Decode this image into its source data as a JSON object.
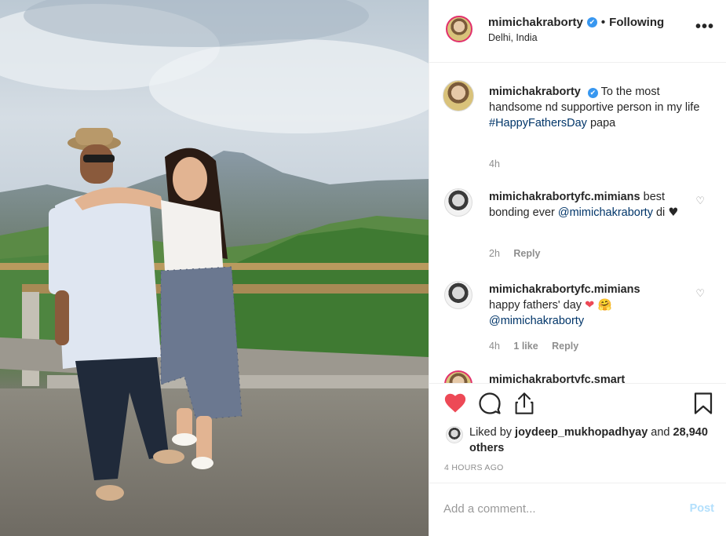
{
  "header": {
    "username": "mimichakraborty",
    "verified_mark": "✔",
    "separator": "•",
    "follow_status": "Following",
    "location": "Delhi, India",
    "more_icon": "•••"
  },
  "caption": {
    "username": "mimichakraborty",
    "verified_mark": "✔",
    "text": "To the most handsome nd supportive person in my life",
    "hashtag": "#HappyFathersDay",
    "text_after": "papa",
    "time": "4h"
  },
  "comments": [
    {
      "username": "mimichakrabortyfc.mimians",
      "text_before": "best bonding ever",
      "mention": "@mimichakraborty",
      "text_after": "di",
      "emoji": "♥",
      "time": "2h",
      "reply_label": "Reply"
    },
    {
      "username": "mimichakrabortyfc.mimians",
      "text_before": "happy fathers' day",
      "emoji": "❤ 🤗",
      "mention": "@mimichakraborty",
      "time": "4h",
      "likes": "1 like",
      "reply_label": "Reply"
    },
    {
      "username_partial": "mimichakrabortyfc.smart"
    }
  ],
  "likes": {
    "prefix": "Liked by",
    "user": "joydeep_mukhopadhyay",
    "connector": "and",
    "others": "28,940 others"
  },
  "timestamp": "4 HOURS AGO",
  "add_comment": {
    "placeholder": "Add a comment...",
    "post_label": "Post"
  },
  "colors": {
    "heart_liked": "#ed4956",
    "link": "#003569",
    "verified": "#3897f0",
    "post_disabled": "#b2dffc"
  },
  "icons": {
    "like": "heart-filled-icon",
    "comment": "comment-bubble-icon",
    "share": "share-icon",
    "save": "bookmark-icon",
    "comment_like": "heart-outline-icon"
  }
}
